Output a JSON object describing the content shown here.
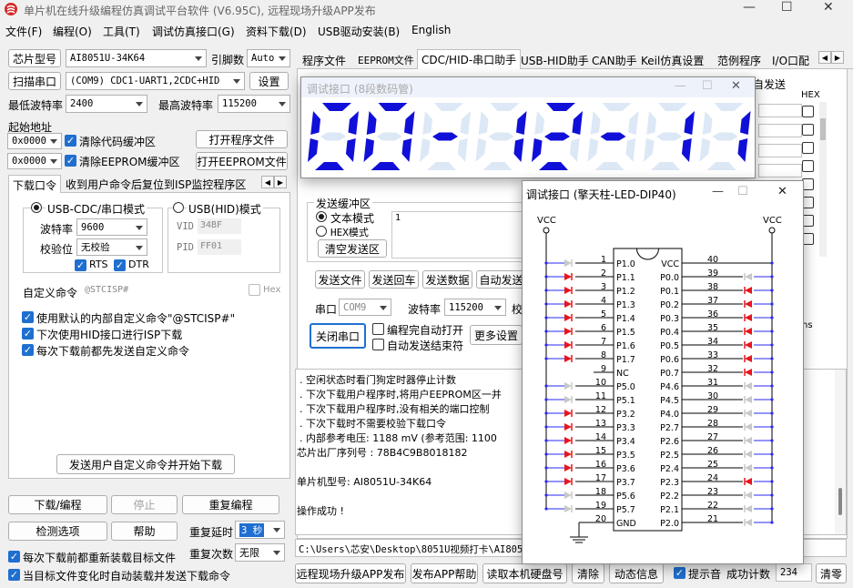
{
  "app": {
    "title": "单片机在线升级编程仿真调试平台软件 (V6.95C), 远程现场升级APP发布",
    "min": "—",
    "max": "☐",
    "close": "✕"
  },
  "menu": [
    "文件(F)",
    "编程(O)",
    "工具(T)",
    "调试仿真接口(G)",
    "资料下载(D)",
    "USB驱动安装(B)",
    "English"
  ],
  "left": {
    "chip_label": "芯片型号",
    "chip_value": "AI8051U-34K64",
    "pins_label": "引脚数",
    "pins_value": "Auto",
    "scan_label": "扫描串口",
    "port_value": "(COM9) CDC1-UART1,2CDC+HID",
    "settings_label": "设置",
    "min_baud_label": "最低波特率",
    "min_baud_value": "2400",
    "max_baud_label": "最高波特率",
    "max_baud_value": "115200",
    "start_addr_label": "起始地址",
    "addr1": "0x0000",
    "clear_code": "清除代码缓冲区",
    "open_prog": "打开程序文件",
    "addr2": "0x0000",
    "clear_eeprom": "清除EEPROM缓冲区",
    "open_eeprom": "打开EEPROM文件",
    "tab1": "下载口令",
    "tab2": "收到用户命令后复位到ISP监控程序区",
    "radio_cdc": "USB-CDC/串口模式",
    "radio_hid": "USB(HID)模式",
    "baud_label": "波特率",
    "baud_value": "9600",
    "parity_label": "校验位",
    "parity_value": "无校验",
    "rts": "RTS",
    "dtr": "DTR",
    "vid_label": "VID",
    "vid_value": "34BF",
    "pid_label": "PID",
    "pid_value": "FF01",
    "custom_label": "自定义命令",
    "custom_value": "@STCISP#",
    "hex_label": "Hex",
    "opt1": "使用默认的内部自定义命令\"@STCISP#\"",
    "opt2": "下次使用HID接口进行ISP下载",
    "opt3": "每次下载前都先发送自定义命令",
    "send_start": "发送用户自定义命令并开始下载",
    "download": "下载/编程",
    "stop": "停止",
    "reprogram": "重复编程",
    "detect": "检测选项",
    "help": "帮助",
    "delay_label": "重复延时",
    "delay_value": "3 秒",
    "count_label": "重复次数",
    "count_value": "无限",
    "reload1": "每次下载前都重新装载目标文件",
    "reload2": "当目标文件变化时自动装载并发送下载命令"
  },
  "tabs": [
    "程序文件",
    "EEPROM文件",
    "CDC/HID-串口助手",
    "USB-HID助手",
    "CAN助手",
    "Keil仿真设置",
    "范例程序",
    "I/O口配"
  ],
  "serial": {
    "partial_header": "自发送",
    "hex_header": "HEX",
    "send_buf_label": "发送缓冲区",
    "text_mode": "文本模式",
    "hex_mode": "HEX模式",
    "clear_send": "清空发送区",
    "send_buf_value": "1",
    "send_file": "发送文件",
    "send_enter": "发送回车",
    "send_data": "发送数据",
    "auto_send": "自动发送",
    "port_label": "串口",
    "port_value": "COM9",
    "baud_label": "波特率",
    "baud_value": "115200",
    "check_partial": "校",
    "close_port": "关闭串口",
    "auto_open": "编程完自动打开",
    "auto_end": "自动发送结束符",
    "more": "更多设置",
    "ns_partial": "ns"
  },
  "log": [
    ". 空闲状态时看门狗定时器停止计数",
    ". 下次下载用户程序时,将用户EEPROM区一并",
    ". 下次下载用户程序时,没有相关的端口控制",
    ". 下次下载时不需要校验下载口令",
    ". 内部参考电压: 1188 mV (参考范围: 1100",
    "芯片出厂序列号 : 78B4C9B8018182",
    "",
    "  单片机型号: AI8051U-34K64",
    "",
    "操作成功 !"
  ],
  "path": "C:\\Users\\芯安\\Desktop\\8051U视频打卡\\AI805",
  "bottom": {
    "publish": "远程现场升级APP发布",
    "publish_help": "发布APP帮助",
    "read_disk": "读取本机硬盘号",
    "clear": "清除",
    "dynamic": "动态信息",
    "prompt": "提示音",
    "success_label": "成功计数",
    "success_value": "234",
    "clear_zero": "清零"
  },
  "seg_window": {
    "title": "调试接口 (8段数码管)",
    "text": "00-12-11"
  },
  "led_window": {
    "title": "调试接口 (擎天柱-LED-DIP40)",
    "vcc": "VCC",
    "gnd_pin_label": "GND",
    "left_pins": [
      {
        "num": "1",
        "name": "P1.0",
        "on": false
      },
      {
        "num": "2",
        "name": "P1.1",
        "on": true
      },
      {
        "num": "3",
        "name": "P1.2",
        "on": true
      },
      {
        "num": "4",
        "name": "P1.3",
        "on": true
      },
      {
        "num": "5",
        "name": "P1.4",
        "on": true
      },
      {
        "num": "6",
        "name": "P1.5",
        "on": true
      },
      {
        "num": "7",
        "name": "P1.6",
        "on": true
      },
      {
        "num": "8",
        "name": "P1.7",
        "on": true
      },
      {
        "num": "9",
        "name": "NC",
        "on": null
      },
      {
        "num": "10",
        "name": "P5.0",
        "on": false
      },
      {
        "num": "11",
        "name": "P5.1",
        "on": false
      },
      {
        "num": "12",
        "name": "P3.2",
        "on": true
      },
      {
        "num": "13",
        "name": "P3.3",
        "on": true
      },
      {
        "num": "14",
        "name": "P3.4",
        "on": true
      },
      {
        "num": "15",
        "name": "P3.5",
        "on": true
      },
      {
        "num": "16",
        "name": "P3.6",
        "on": true
      },
      {
        "num": "17",
        "name": "P3.7",
        "on": true
      },
      {
        "num": "18",
        "name": "P5.6",
        "on": false
      },
      {
        "num": "19",
        "name": "P5.7",
        "on": false
      },
      {
        "num": "20",
        "name": "GND",
        "on": null
      }
    ],
    "right_pins": [
      {
        "num": "40",
        "name": "VCC",
        "on": null
      },
      {
        "num": "39",
        "name": "P0.0",
        "on": false
      },
      {
        "num": "38",
        "name": "P0.1",
        "on": true
      },
      {
        "num": "37",
        "name": "P0.2",
        "on": true
      },
      {
        "num": "36",
        "name": "P0.3",
        "on": true
      },
      {
        "num": "35",
        "name": "P0.4",
        "on": true
      },
      {
        "num": "34",
        "name": "P0.5",
        "on": true
      },
      {
        "num": "33",
        "name": "P0.6",
        "on": true
      },
      {
        "num": "32",
        "name": "P0.7",
        "on": true
      },
      {
        "num": "31",
        "name": "P4.6",
        "on": false
      },
      {
        "num": "30",
        "name": "P4.5",
        "on": false
      },
      {
        "num": "29",
        "name": "P4.0",
        "on": false
      },
      {
        "num": "28",
        "name": "P2.7",
        "on": false
      },
      {
        "num": "27",
        "name": "P2.6",
        "on": false
      },
      {
        "num": "26",
        "name": "P2.5",
        "on": false
      },
      {
        "num": "25",
        "name": "P2.4",
        "on": false
      },
      {
        "num": "24",
        "name": "P2.3",
        "on": true
      },
      {
        "num": "23",
        "name": "P2.2",
        "on": false
      },
      {
        "num": "22",
        "name": "P2.1",
        "on": false
      },
      {
        "num": "21",
        "name": "P2.0",
        "on": false
      }
    ]
  },
  "colors": {
    "led_on": "#e8141c",
    "led_off": "#c8c8c8",
    "seg_on": "#1010d8",
    "seg_off": "#dde8f6",
    "accent": "#1f6fd0"
  }
}
